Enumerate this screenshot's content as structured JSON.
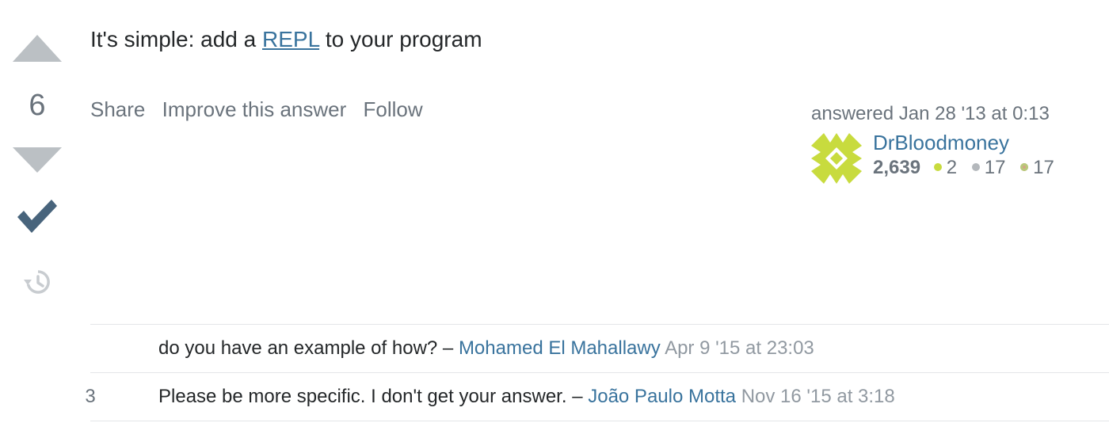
{
  "vote": {
    "count": "6"
  },
  "post": {
    "text_before": "It's simple: add a ",
    "link_text": "REPL",
    "text_after": " to your program"
  },
  "menu": {
    "share": "Share",
    "improve": "Improve this answer",
    "follow": "Follow"
  },
  "user": {
    "action_time": "answered Jan 28 '13 at 0:13",
    "name": "DrBloodmoney",
    "reputation": "2,639",
    "gold": "2",
    "silver": "17",
    "bronze": "17"
  },
  "comments": [
    {
      "score": "",
      "text": "do you have an example of how?",
      "separator": " – ",
      "user": "Mohamed El Mahallawy",
      "date": "Apr 9 '15 at 23:03"
    },
    {
      "score": "3",
      "text": "Please be more specific. I don't get your answer.",
      "separator": " – ",
      "user": "João Paulo Motta",
      "date": "Nov 16 '15 at 3:18"
    }
  ],
  "colors": {
    "link": "#39739d",
    "muted": "#6a737c",
    "vote_arrow": "#bbc0c4",
    "accepted": "#48647c",
    "avatar": "#c8db3e",
    "gold": "#ffcc01",
    "silver": "#b4b8bc",
    "bronze": "#d1a684"
  }
}
